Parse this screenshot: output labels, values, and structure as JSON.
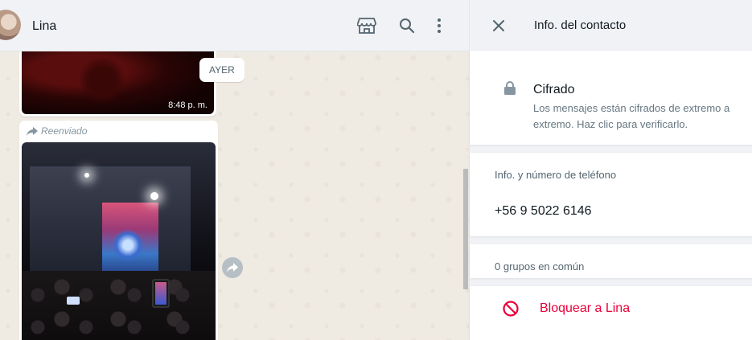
{
  "chat": {
    "contact_name": "Lina",
    "header_icons": [
      "catalog-icon",
      "search-icon",
      "menu-icon"
    ],
    "day_separator": "AYER",
    "messages": [
      {
        "type": "image",
        "time": "8:48 p. m."
      },
      {
        "type": "image",
        "forwarded_label": "Reenviado"
      }
    ]
  },
  "contact_info": {
    "title": "Info. del contacto",
    "encryption": {
      "title": "Cifrado",
      "description": "Los mensajes están cifrados de extremo a extremo. Haz clic para verificarlo."
    },
    "phone_section_label": "Info. y número de teléfono",
    "phone_number": "+56 9 5022 6146",
    "groups_in_common": "0 grupos en común",
    "block_label": "Bloquear a Lina"
  },
  "colors": {
    "danger": "#ea0038",
    "chat_background": "#efeae2",
    "panel_background": "#f0f2f5",
    "secondary_text": "#667781"
  }
}
